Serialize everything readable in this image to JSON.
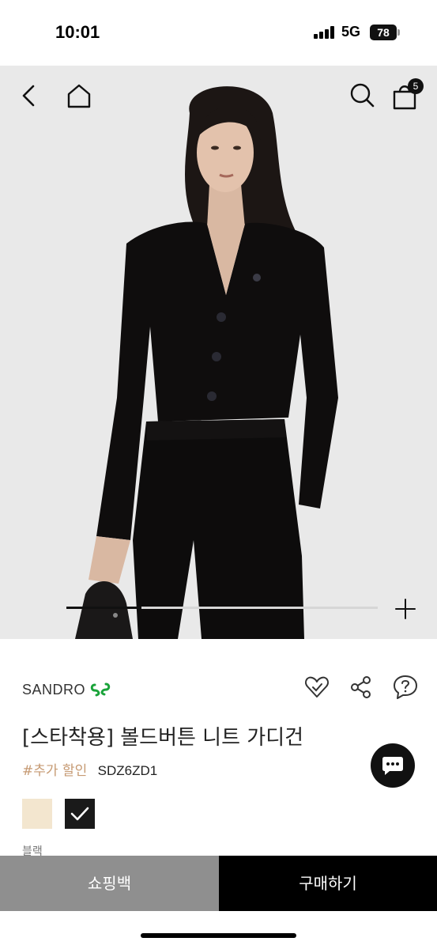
{
  "status_bar": {
    "time": "10:01",
    "network": "5G",
    "battery": "78"
  },
  "nav": {
    "back_icon": "chevron-left-icon",
    "home_icon": "home-icon",
    "search_icon": "search-icon",
    "cart_icon": "shopping-bag-icon",
    "cart_count": "5"
  },
  "gallery": {
    "progress": 0.24
  },
  "product": {
    "brand": "SANDRO",
    "title": "[스타착용] 볼드버튼 니트 가디건",
    "promo_tag": "#추가 할인",
    "code": "SDZ6ZD1",
    "selected_color": "블랙",
    "swatches": [
      {
        "color": "#f3e6cf",
        "selected": false
      },
      {
        "color": "#1a1a1a",
        "selected": true
      }
    ]
  },
  "actions": {
    "wishlist_icon": "heart-icon",
    "share_icon": "share-icon",
    "qna_icon": "question-bubble-icon",
    "chat_icon": "chat-icon"
  },
  "bottom_bar": {
    "bag_label": "쇼핑백",
    "buy_label": "구매하기"
  },
  "colors": {
    "promo": "#c69a73",
    "brand_logo": "#1aa33a",
    "bag_button": "#8f8f8f",
    "buy_button": "#000000"
  }
}
